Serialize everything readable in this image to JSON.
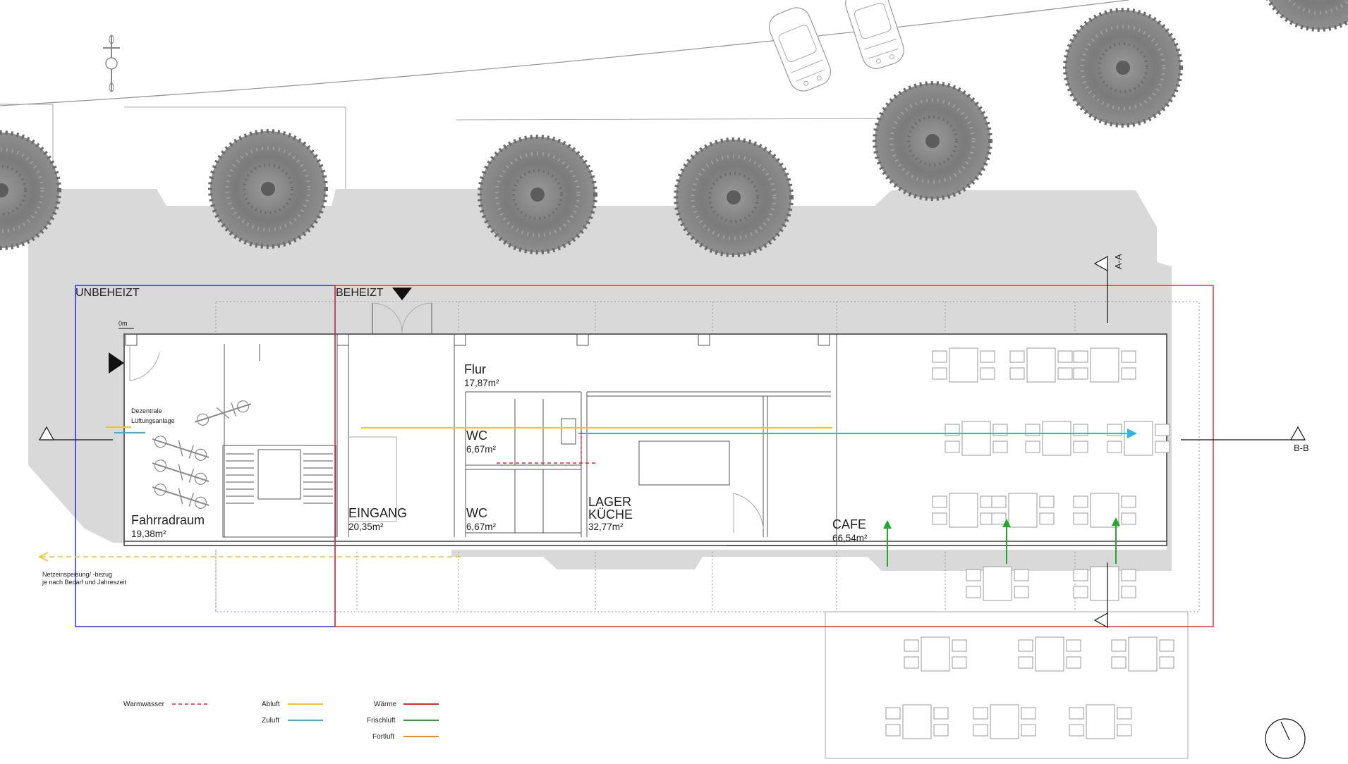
{
  "zones": {
    "unheated": "UNBEHEIZT",
    "heated": "BEHEIZT"
  },
  "level_marker": "0m",
  "rooms": {
    "fahrradraum": {
      "name": "Fahrradraum",
      "area": "19,38m²"
    },
    "eingang": {
      "name": "EINGANG",
      "area": "20,35m²"
    },
    "flur": {
      "name": "Flur",
      "area": "17,87m²"
    },
    "wc1": {
      "name": "WC",
      "area": "6,67m²"
    },
    "wc2": {
      "name": "WC",
      "area": "6,67m²"
    },
    "lager": {
      "name1": "LAGER",
      "name2": "KÜCHE",
      "area": "32,77m²"
    },
    "cafe": {
      "name": "CAFE",
      "area": "66,54m²"
    }
  },
  "notes": {
    "ventilation_1": "Dezentrale",
    "ventilation_2": "Lüftungsanlage",
    "grid_1": "Netzeinspeisung/ -bezug",
    "grid_2": "je nach Bedarf und Jahreszeit"
  },
  "sections": {
    "a": "A-A",
    "b": "B-B"
  },
  "legend": {
    "warmwasser": "Warmwasser",
    "abluft": "Abluft",
    "zuluft": "Zuluft",
    "waerme": "Wärme",
    "frischluft": "Frischluft",
    "fortluft": "Fortluft"
  },
  "colors": {
    "unheated": "#1f1fd6",
    "heated": "#e8262c",
    "warmwasser": "#e8262c",
    "abluft": "#f5c518",
    "zuluft": "#29b6e8",
    "waerme": "#e8262c",
    "frischluft": "#1faa2a",
    "fortluft": "#f08a1c",
    "tree": "#777777",
    "ground": "#d9d9d9"
  },
  "icons": [
    "tree-icon",
    "car-icon",
    "bicycle-icon",
    "north-arrow-icon",
    "entrance-arrow-icon",
    "section-marker-icon"
  ]
}
